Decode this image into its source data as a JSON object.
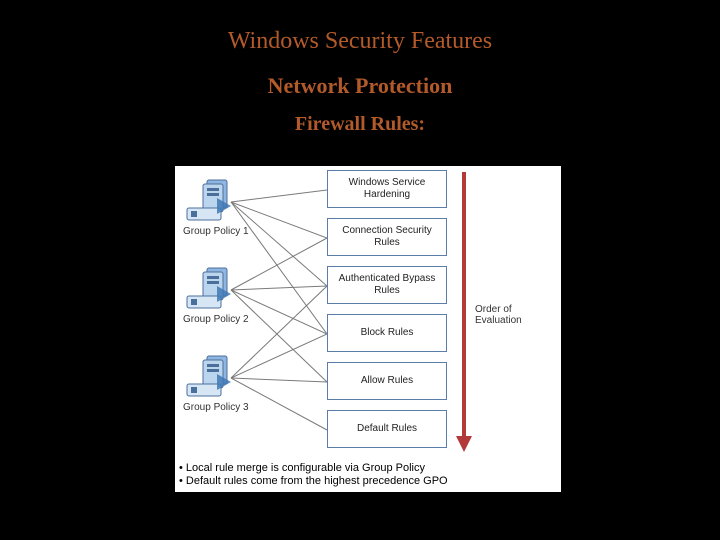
{
  "title": "Windows Security Features",
  "subtitle": "Network Protection",
  "subsub": "Firewall Rules:",
  "group_policies": [
    {
      "label": "Group Policy 1"
    },
    {
      "label": "Group Policy 2"
    },
    {
      "label": "Group Policy 3"
    }
  ],
  "rules": [
    "Windows Service Hardening",
    "Connection Security Rules",
    "Authenticated Bypass Rules",
    "Block Rules",
    "Allow Rules",
    "Default Rules"
  ],
  "evaluation_label": "Order of Evaluation",
  "bullets": [
    "Local rule merge is configurable via Group Policy",
    "Default rules come from the highest precedence GPO"
  ]
}
